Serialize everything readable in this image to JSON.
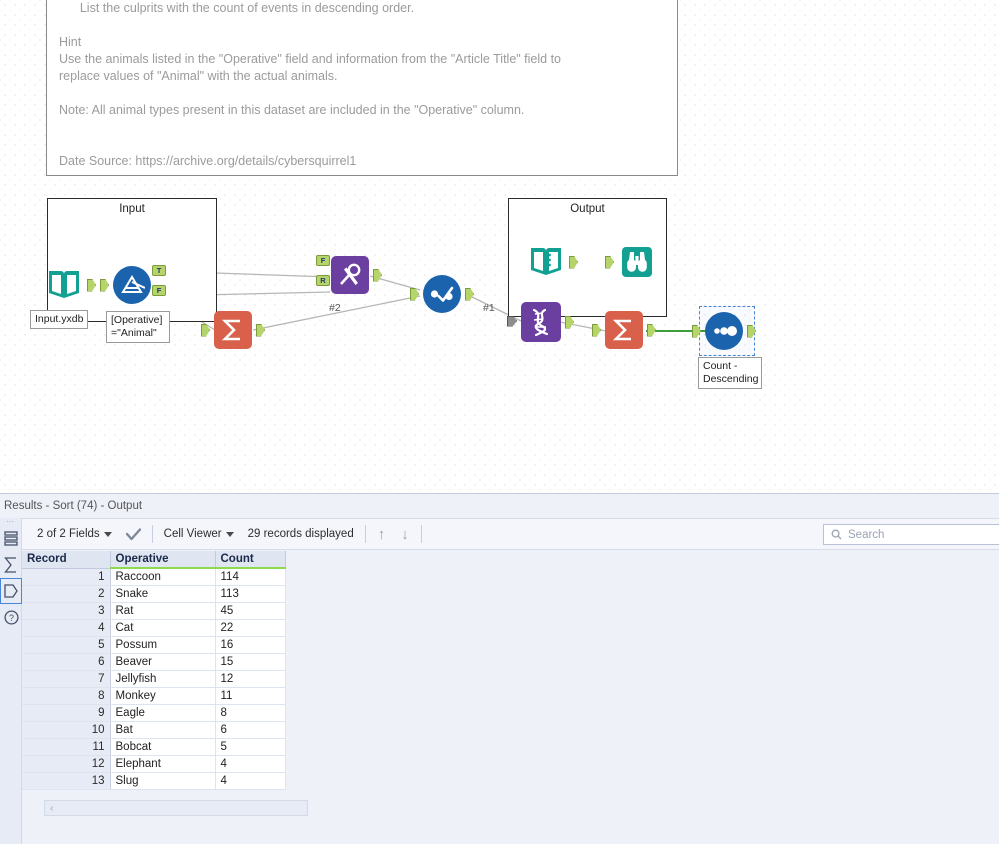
{
  "canvas": {
    "comment": {
      "text": "List the culprits with the count of events in descending order.\n\nHint\nUse the animals listed in the \"Operative\" field and information from the \"Article Title\" field to\nreplace values of \"Animal\" with the actual animals.\n\nNote: All animal types present in this dataset are included in the \"Operative\" column.\n\n\nDate Source: https://archive.org/details/cybersquirrel1"
    },
    "containers": [
      {
        "title": "Input"
      },
      {
        "title": "Output"
      }
    ],
    "labels": {
      "input_file": "Input.yxdb",
      "filter_expr": "[Operative]\n=\"Animal\"",
      "sort_config": "Count -\nDescending",
      "conn_1": "#1",
      "conn_2": "#2",
      "filter_true": "T",
      "filter_false": "F",
      "findreplace_f": "F",
      "findreplace_r": "R"
    },
    "tools": [
      {
        "name": "input-data-tool",
        "label": "Input Data"
      },
      {
        "name": "filter-tool",
        "label": "Filter"
      },
      {
        "name": "summarize-tool-1",
        "label": "Summarize"
      },
      {
        "name": "find-replace-tool",
        "label": "Find Replace"
      },
      {
        "name": "union-tool",
        "label": "Union"
      },
      {
        "name": "regex-tool",
        "label": "RegEx"
      },
      {
        "name": "summarize-tool-2",
        "label": "Summarize"
      },
      {
        "name": "sort-tool",
        "label": "Sort"
      },
      {
        "name": "output-data-tool",
        "label": "Output Data"
      },
      {
        "name": "browse-tool",
        "label": "Browse"
      }
    ],
    "colors": {
      "teal": "#12a092",
      "blue": "#1c63ad",
      "purple": "#6b3fa0",
      "orange": "#d9604a",
      "nub_green": "#b5d46a",
      "wire": "#b6b6b6",
      "wire_active": "#3d9e3d"
    }
  },
  "results": {
    "title": "Results - Sort (74) - Output",
    "toolbar": {
      "fields_label": "2 of 2 Fields",
      "check_icon": "check-icon",
      "viewer_label": "Cell Viewer",
      "records_label": "29 records displayed",
      "up_arrow": "↑",
      "down_arrow": "↓"
    },
    "search": {
      "placeholder": "Search",
      "value": "",
      "icon": "search-icon"
    },
    "rail": [
      {
        "name": "rail-item-grid",
        "icon": "grid-icon"
      },
      {
        "name": "rail-item-sigma",
        "icon": "sigma-icon"
      },
      {
        "name": "rail-item-tag",
        "icon": "tag-icon"
      },
      {
        "name": "rail-item-help",
        "icon": "question-icon"
      }
    ],
    "grid": {
      "columns": [
        "Record",
        "Operative",
        "Count"
      ],
      "rows": [
        {
          "record": "1",
          "operative": "Raccoon",
          "count": "114"
        },
        {
          "record": "2",
          "operative": "Snake",
          "count": "113"
        },
        {
          "record": "3",
          "operative": "Rat",
          "count": "45"
        },
        {
          "record": "4",
          "operative": "Cat",
          "count": "22"
        },
        {
          "record": "5",
          "operative": "Possum",
          "count": "16"
        },
        {
          "record": "6",
          "operative": "Beaver",
          "count": "15"
        },
        {
          "record": "7",
          "operative": "Jellyfish",
          "count": "12"
        },
        {
          "record": "8",
          "operative": "Monkey",
          "count": "11"
        },
        {
          "record": "9",
          "operative": "Eagle",
          "count": "8"
        },
        {
          "record": "10",
          "operative": "Bat",
          "count": "6"
        },
        {
          "record": "11",
          "operative": "Bobcat",
          "count": "5"
        },
        {
          "record": "12",
          "operative": "Elephant",
          "count": "4"
        },
        {
          "record": "13",
          "operative": "Slug",
          "count": "4"
        }
      ]
    },
    "hscroll": {
      "left_arrow": "‹"
    }
  }
}
